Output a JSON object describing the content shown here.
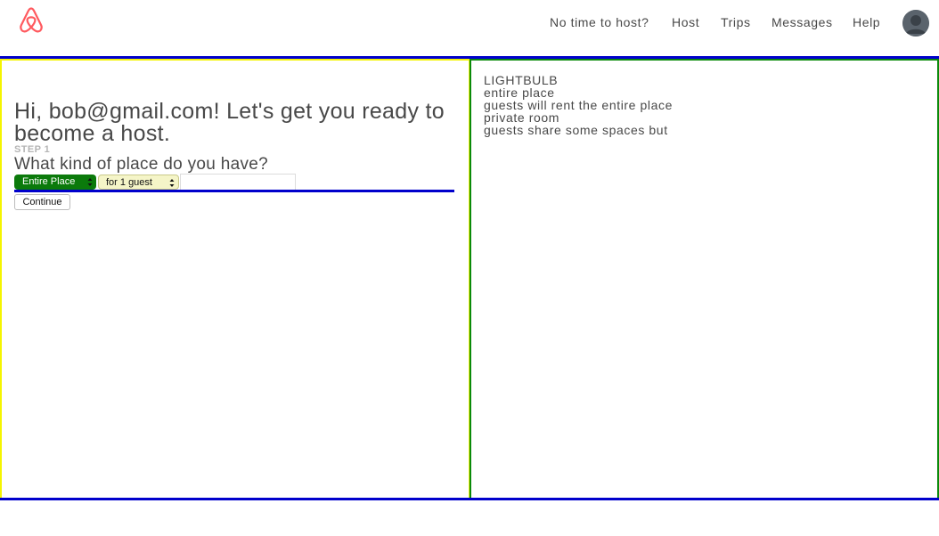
{
  "brand": {
    "logo_icon": "airbnb-belo-icon",
    "logo_color": "#ff5a5f"
  },
  "nav": {
    "items": [
      {
        "label": "No time to host?"
      },
      {
        "label": "Host"
      },
      {
        "label": "Trips"
      },
      {
        "label": "Messages"
      },
      {
        "label": "Help"
      }
    ],
    "avatar_icon": "user-avatar-icon"
  },
  "main": {
    "headline": "Hi, bob@gmail.com! Let's get you ready to become a host.",
    "step_label": "STEP 1",
    "question": "What kind of place do you have?",
    "place_type": {
      "selected": "Entire Place"
    },
    "guests": {
      "selected": "for 1 guest"
    },
    "city_input": {
      "value": "",
      "placeholder": ""
    },
    "continue_label": "Continue"
  },
  "tips": {
    "lines": [
      "LIGHTBULB",
      "entire place",
      "guests will rent the entire place",
      "private room",
      "guests share some spaces but"
    ]
  },
  "colors": {
    "left_border": "#f5f500",
    "right_border": "#0a8a0a",
    "divider": "#0000cc",
    "place_select_bg": "#0b7a0b",
    "guest_select_bg": "#f5f5c8"
  }
}
